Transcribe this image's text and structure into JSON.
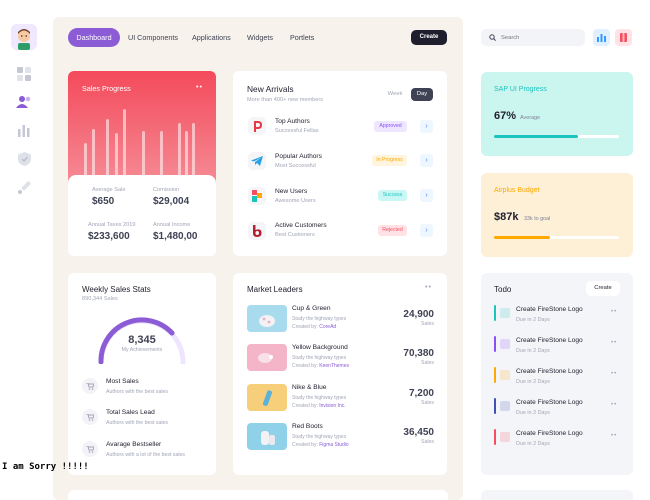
{
  "nav": {
    "items": [
      "Dashboard",
      "UI Components",
      "Applications",
      "Widgets",
      "Portlets"
    ],
    "create_label": "Create"
  },
  "sales_progress": {
    "title": "Sales Progress",
    "stats": [
      {
        "label": "Average Sale",
        "value": "$650"
      },
      {
        "label": "Comission",
        "value": "$29,004"
      },
      {
        "label": "Annual Taxes 2019",
        "value": "$233,600"
      },
      {
        "label": "Annual Income",
        "value": "$1,480,00"
      }
    ]
  },
  "new_arrivals": {
    "title": "New Arrivals",
    "subtitle": "More than 400+ new members",
    "tabs": [
      "Week",
      "Day"
    ],
    "items": [
      {
        "name": "Top Authors",
        "desc": "Successful Fellas",
        "status": "Approved",
        "icon": "pinterest-icon"
      },
      {
        "name": "Popular Authors",
        "desc": "Most Successful",
        "status": "In Progress",
        "icon": "telegram-icon"
      },
      {
        "name": "New Users",
        "desc": "Awesome Users",
        "status": "Success",
        "icon": "leaf-icon"
      },
      {
        "name": "Active Customers",
        "desc": "Best Customers",
        "status": "Rejected",
        "icon": "bebo-icon"
      }
    ]
  },
  "weekly": {
    "title": "Weekly Sales Stats",
    "subtitle": "890,344 Sales",
    "gauge_value": "8,345",
    "gauge_caption": "My Achievements",
    "items": [
      {
        "name": "Most Sales",
        "desc": "Authors with the best sales"
      },
      {
        "name": "Total Sales Lead",
        "desc": "Authors with the best sales"
      },
      {
        "name": "Avarage Bestseller",
        "desc": "Authors with a lot of the best sales"
      }
    ]
  },
  "market": {
    "title": "Market Leaders",
    "items": [
      {
        "name": "Cup & Green",
        "desc": "Study the highway types",
        "by_label": "Created by:",
        "author": "CoreAd",
        "value": "24,900",
        "unit": "Sales"
      },
      {
        "name": "Yellow Background",
        "desc": "Study the highway types",
        "by_label": "Created by:",
        "author": "KeenThemes",
        "value": "70,380",
        "unit": "Sales"
      },
      {
        "name": "Nike & Blue",
        "desc": "Study the highway types",
        "by_label": "Created by:",
        "author": "Invision Inc.",
        "value": "7,200",
        "unit": "Sales"
      },
      {
        "name": "Red Boots",
        "desc": "Study the highway types",
        "by_label": "Created by:",
        "author": "Figma Studio",
        "value": "36,450",
        "unit": "Sales"
      }
    ]
  },
  "search": {
    "placeholder": "Search"
  },
  "sap": {
    "title": "SAP UI Progress",
    "value": "67%",
    "caption": "Average",
    "progress": 0.67
  },
  "budget": {
    "title": "Airplus Budget",
    "value": "$87k",
    "caption": "33k to goal",
    "progress": 0.45
  },
  "todo": {
    "title": "Todo",
    "create_label": "Create",
    "items": [
      {
        "name": "Create FireStone Logo",
        "due": "Due in 2 Days",
        "color": "#1bc5bd"
      },
      {
        "name": "Create FireStone Logo",
        "due": "Due in 2 Days",
        "color": "#8950fc"
      },
      {
        "name": "Create FireStone Logo",
        "due": "Due in 2 Days",
        "color": "#ffa800"
      },
      {
        "name": "Create FireStone Logo",
        "due": "Due in 2 Days",
        "color": "#3f51b5"
      },
      {
        "name": "Create FireStone Logo",
        "due": "Due in 2 Days",
        "color": "#f64e60"
      }
    ]
  },
  "overlay_text": "I am Sorry !!!!!"
}
